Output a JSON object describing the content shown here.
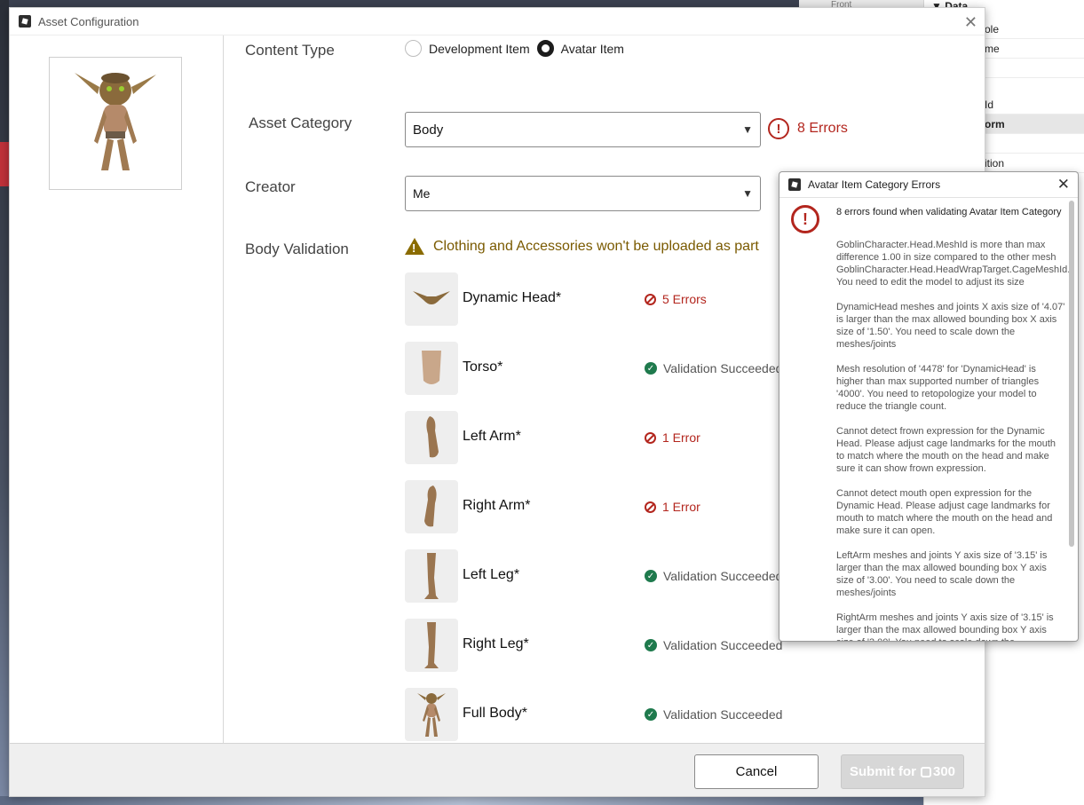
{
  "background": {
    "right_panel": {
      "section_header": "▼ Data",
      "props": [
        "ole",
        "me",
        "",
        "Id",
        "orm",
        "",
        "ition"
      ]
    },
    "top_label": "Front"
  },
  "window": {
    "title": "Asset Configuration",
    "close_glyph": "✕"
  },
  "form": {
    "content_type": {
      "label": "Content Type",
      "options": [
        "Development Item",
        "Avatar Item"
      ],
      "selected": "Avatar Item"
    },
    "asset_category": {
      "label": "Asset Category",
      "value": "Body",
      "error_summary": "8 Errors"
    },
    "creator": {
      "label": "Creator",
      "value": "Me"
    },
    "body_validation": {
      "label": "Body Validation",
      "warning": "Clothing and Accessories won't be uploaded as part",
      "parts": [
        {
          "name": "Dynamic Head*",
          "status": "5 Errors",
          "ok": false
        },
        {
          "name": "Torso*",
          "status": "Validation Succeeded",
          "ok": true
        },
        {
          "name": "Left Arm*",
          "status": "1 Error",
          "ok": false
        },
        {
          "name": "Right Arm*",
          "status": "1 Error",
          "ok": false
        },
        {
          "name": "Left Leg*",
          "status": "Validation Succeeded",
          "ok": true
        },
        {
          "name": "Right Leg*",
          "status": "Validation Succeeded",
          "ok": true
        },
        {
          "name": "Full Body*",
          "status": "Validation Succeeded",
          "ok": true
        }
      ]
    }
  },
  "footer": {
    "cancel_label": "Cancel",
    "submit_label": "Submit for",
    "submit_price": "300"
  },
  "errors_popup": {
    "title": "Avatar Item Category Errors",
    "heading": "8 errors found when validating Avatar Item Category",
    "errors": [
      "GoblinCharacter.Head.MeshId is more than max difference 1.00 in size compared to the other mesh GoblinCharacter.Head.HeadWrapTarget.CageMeshId. You need to edit the model to adjust its size",
      "DynamicHead meshes and joints X axis size of '4.07' is larger than the max allowed bounding box X axis size of '1.50'. You need to scale down the meshes/joints",
      "Mesh resolution of '4478' for 'DynamicHead' is higher than max supported number of triangles '4000'. You need to retopologize your model to reduce the triangle count.",
      "Cannot detect frown expression for the Dynamic Head. Please adjust cage landmarks for the mouth to match where the mouth on the head and make sure it can show frown expression.",
      "Cannot detect mouth open expression for the Dynamic Head. Please adjust cage landmarks for mouth to match where the mouth on the head and make sure it can open.",
      "LeftArm meshes and joints Y axis size of '3.15' is larger than the max allowed bounding box Y axis size of '3.00'. You need to scale down the meshes/joints",
      "RightArm meshes and joints Y axis size of '3.15' is larger than the max allowed bounding box Y axis size of '3.00'. You need to scale down the"
    ]
  },
  "colors": {
    "error": "#b3261e",
    "success": "#1f7a4d",
    "warning": "#7a5a00"
  }
}
